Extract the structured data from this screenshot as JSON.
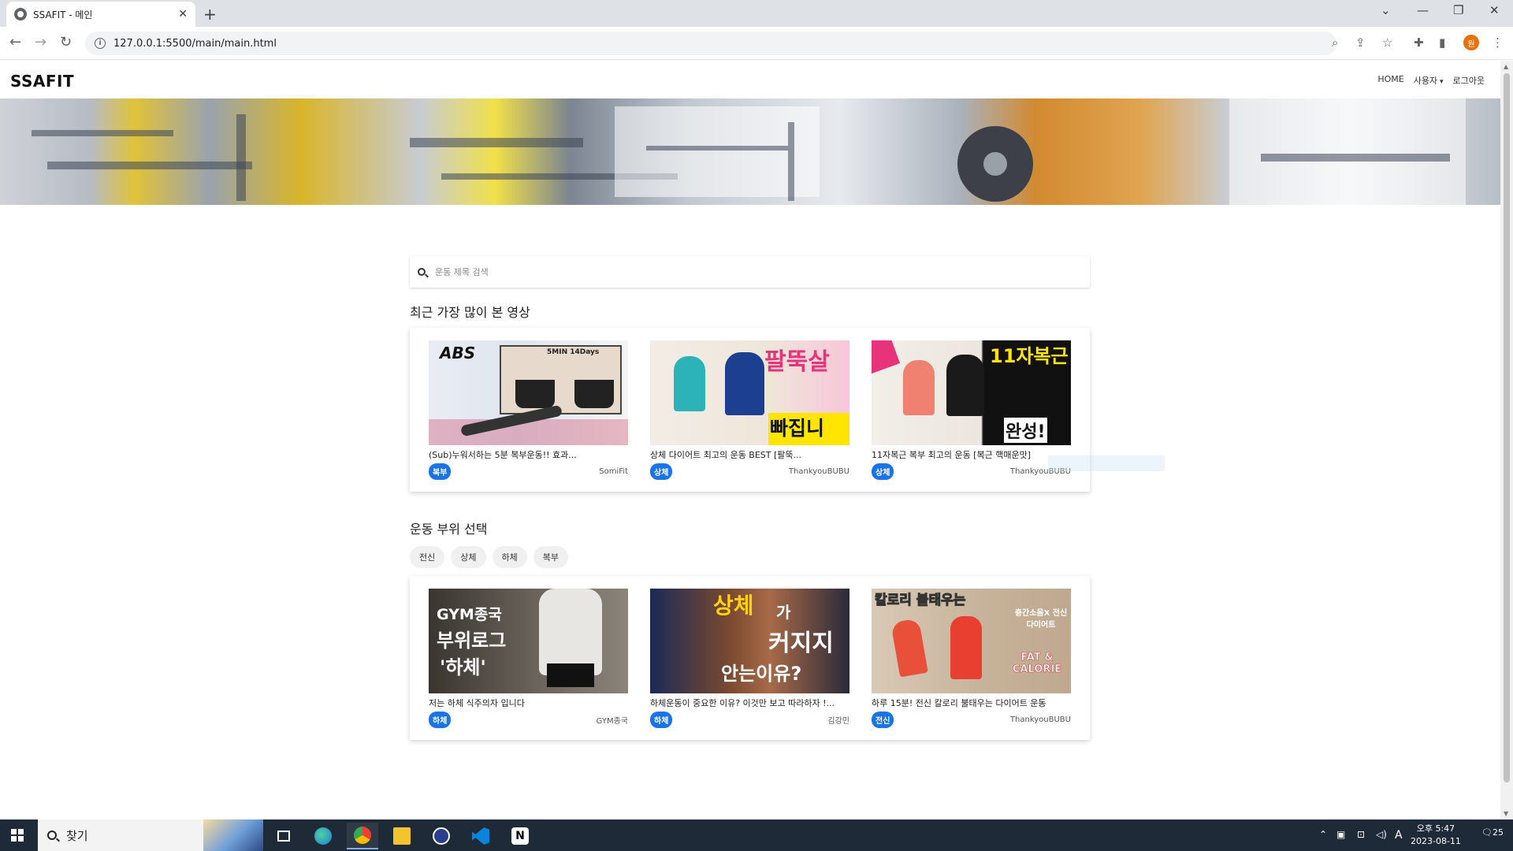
{
  "browser": {
    "tab_title": "SSAFIT - 메인",
    "tab_close": "✕",
    "new_tab": "+",
    "url": "127.0.0.1:5500/main/main.html",
    "profile_initial": "원"
  },
  "site": {
    "brand": "SSAFIT",
    "nav": {
      "home": "HOME",
      "user": "사용자",
      "logout": "로그아웃"
    }
  },
  "search": {
    "placeholder": "운동 제목 검색",
    "value": ""
  },
  "popular": {
    "heading": "최근 가장 많이 본 영상",
    "videos": [
      {
        "title": "(Sub)누워서하는 5분 복부운동!! 효과...",
        "badge": "복부",
        "channel": "SomiFit",
        "thumb_text": "ABS",
        "thumb_text2": "5MIN 14Days"
      },
      {
        "title": "상체 다이어트 최고의 운동 BEST [팔뚝...",
        "badge": "상체",
        "channel": "ThankyouBUBU",
        "thumb_text": "팔뚝살",
        "thumb_text2": "빠집니다!"
      },
      {
        "title": "11자복근 복부 최고의 운동 [복근 핵매운맛]",
        "badge": "상체",
        "channel": "ThankyouBUBU",
        "thumb_text": "11자복근",
        "thumb_text2": "완성!"
      }
    ]
  },
  "parts": {
    "heading": "운동 부위 선택",
    "chips": [
      "전신",
      "상체",
      "하체",
      "복부"
    ],
    "videos": [
      {
        "title": "저는 하체 식주의자 입니다",
        "badge": "하체",
        "channel": "GYM종국",
        "thumb_text": "GYM종국",
        "thumb_text2": "'하체'"
      },
      {
        "title": "하체운동이 중요한 이유? 이것만 보고 따라하자 !...",
        "badge": "하체",
        "channel": "김강민",
        "thumb_text": "상체",
        "thumb_text2": "안는이유?"
      },
      {
        "title": "하루 15분! 전신 칼로리 불태우는 다이어트 운동",
        "badge": "전신",
        "channel": "ThankyouBUBU",
        "thumb_text": "칼로리 불태우는",
        "thumb_text2": "FAT & CALORIE"
      }
    ]
  },
  "taskbar": {
    "search_label": "찾기",
    "time": "오후 5:47",
    "date": "2023-08-11",
    "notifications": "25",
    "ime": "A"
  },
  "colors": {
    "badge": "#1a73e8",
    "taskbar": "#1f2a38",
    "profile": "#e8710a"
  }
}
